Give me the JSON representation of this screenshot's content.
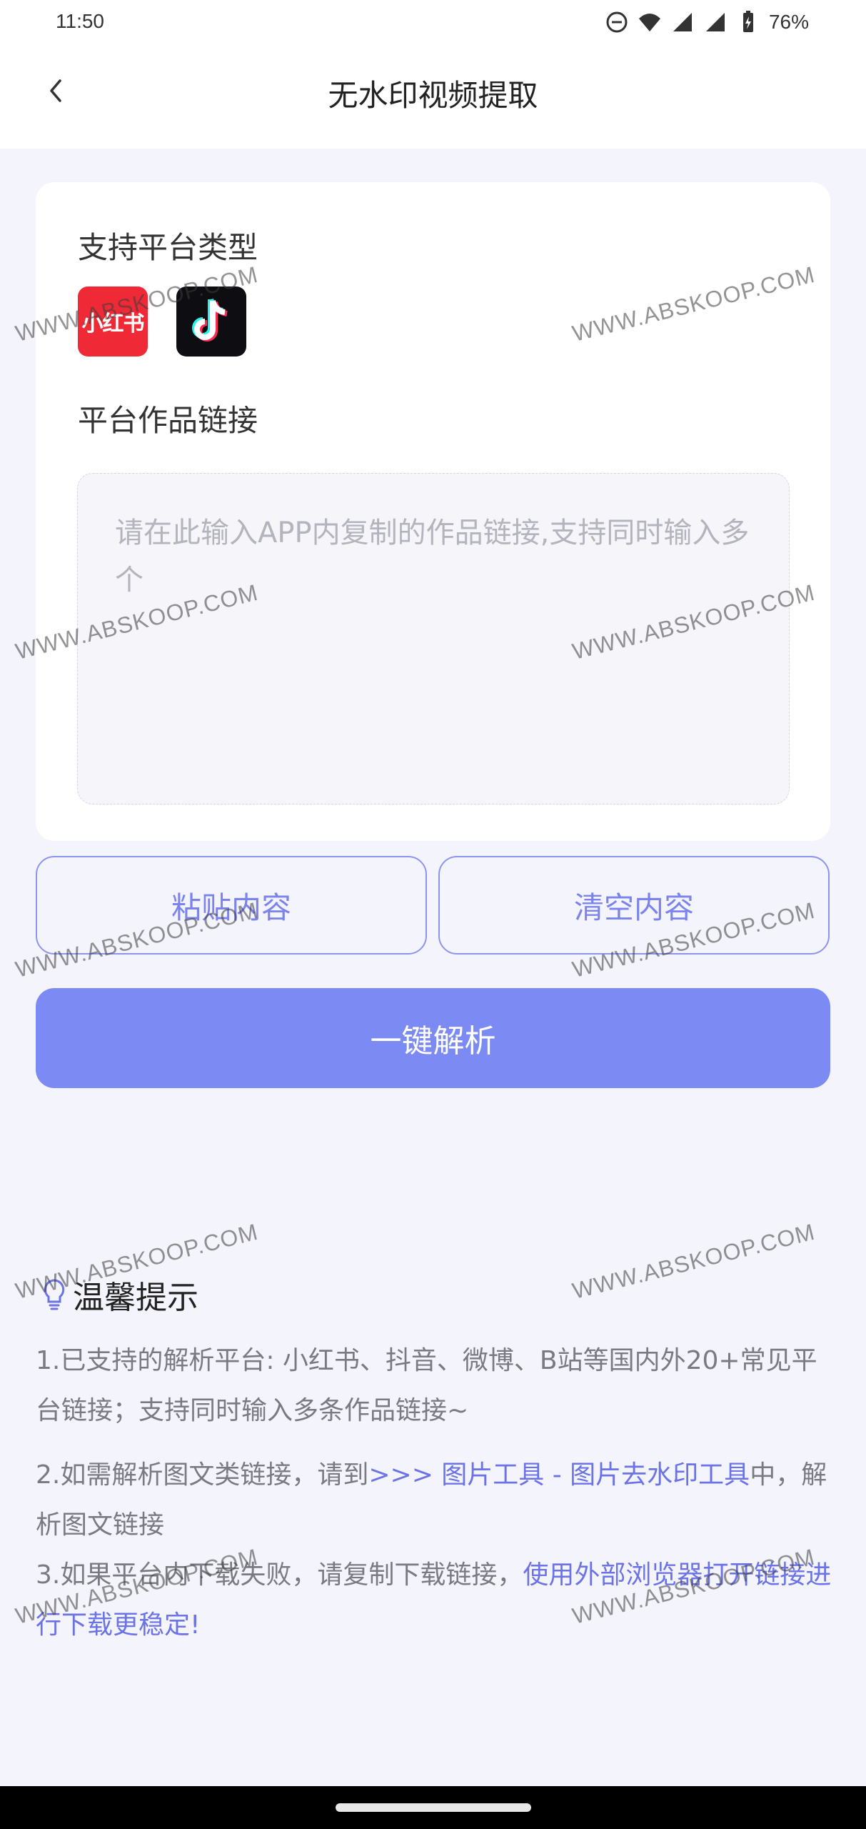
{
  "status_bar": {
    "time": "11:50",
    "battery": "76%"
  },
  "header": {
    "title": "无水印视频提取"
  },
  "card": {
    "platforms_label": "支持平台类型",
    "platforms": [
      {
        "name": "小红书",
        "icon": "xiaohongshu-icon",
        "color": "#ef2a36"
      },
      {
        "name": "tiktok",
        "icon": "tiktok-icon",
        "color": "#0e0e12"
      }
    ],
    "link_label": "平台作品链接",
    "link_placeholder": "请在此输入APP内复制的作品链接,支持同时输入多个"
  },
  "actions": {
    "paste_label": "粘贴内容",
    "clear_label": "清空内容",
    "parse_label": "一键解析"
  },
  "tips": {
    "title": "温馨提示",
    "tip1": "1.已支持的解析平台: 小红书、抖音、微博、B站等国内外20+常见平台链接；支持同时输入多条作品链接~",
    "tip2_prefix": "2.如需解析图文类链接，请到",
    "tip2_link": ">>> 图片工具 - 图片去水印工具",
    "tip2_suffix": "中，解析图文链接",
    "tip3_prefix": "3.如果平台内下载失败，请复制下载链接，",
    "tip3_link": "使用外部浏览器打开链接进行下载更稳定!"
  },
  "watermark_text": "WWW.ABSKOOP.COM",
  "colors": {
    "accent": "#7c8bf3",
    "link": "#6b73e6",
    "background": "#f4f4fc"
  }
}
